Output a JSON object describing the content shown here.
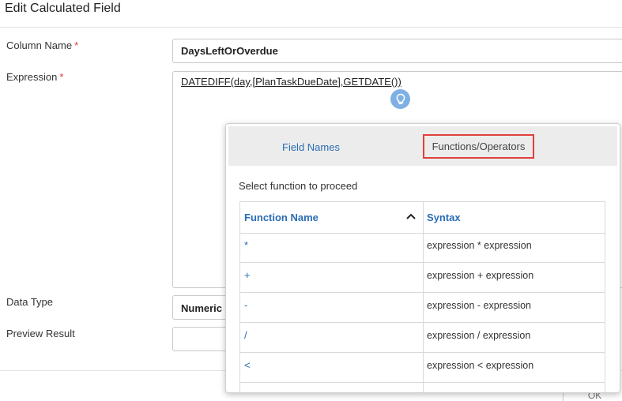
{
  "dialog": {
    "title": "Edit Calculated Field",
    "ok_label": "OK"
  },
  "form": {
    "column_name": {
      "label": "Column Name",
      "required_mark": "*",
      "value": "DaysLeftOrOverdue"
    },
    "expression": {
      "label": "Expression",
      "required_mark": "*",
      "value": "DATEDIFF(day,[PlanTaskDueDate],GETDATE())"
    },
    "data_type": {
      "label": "Data Type",
      "value": "Numeric"
    },
    "preview_result": {
      "label": "Preview Result",
      "value": ""
    }
  },
  "popover": {
    "tabs": [
      {
        "label": "Field Names",
        "active": false
      },
      {
        "label": "Functions/Operators",
        "active": true
      }
    ],
    "instruction": "Select function to proceed",
    "table": {
      "headers": {
        "name": "Function Name",
        "syntax": "Syntax"
      },
      "rows": [
        {
          "name": "*",
          "syntax": "expression * expression"
        },
        {
          "name": "+",
          "syntax": "expression + expression"
        },
        {
          "name": "-",
          "syntax": "expression - expression"
        },
        {
          "name": "/",
          "syntax": "expression / expression"
        },
        {
          "name": "<",
          "syntax": "expression < expression"
        }
      ]
    }
  },
  "colors": {
    "link_blue": "#2a6db5",
    "highlight_red": "#e0403a",
    "required_red": "#e0343f",
    "bulb_blue": "#7fb0e4"
  },
  "icons": {
    "hint": "lightbulb-icon",
    "sort": "chevron-up-icon"
  }
}
